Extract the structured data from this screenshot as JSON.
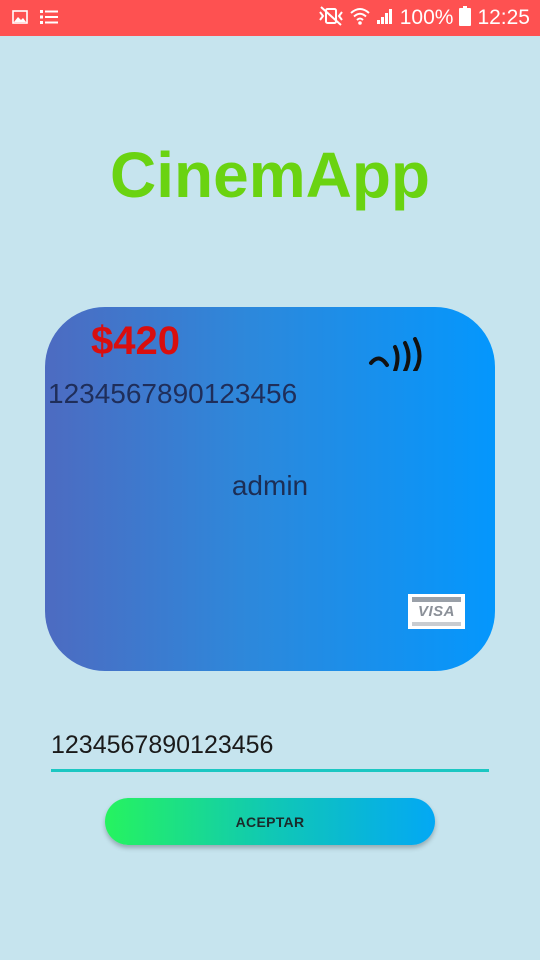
{
  "status_bar": {
    "battery": "100%",
    "time": "12:25",
    "color": "#fe5151"
  },
  "app": {
    "title": "CinemApp",
    "title_color": "#6ad311",
    "background": "#c6e4ee"
  },
  "card": {
    "amount": "$420",
    "number": "1234567890123456",
    "holder": "admin",
    "brand": "VISA",
    "brand_icon": "visa-icon",
    "contactless_icon": "contactless-icon"
  },
  "form": {
    "card_input_value": "1234567890123456",
    "accept_label": "ACEPTAR"
  }
}
